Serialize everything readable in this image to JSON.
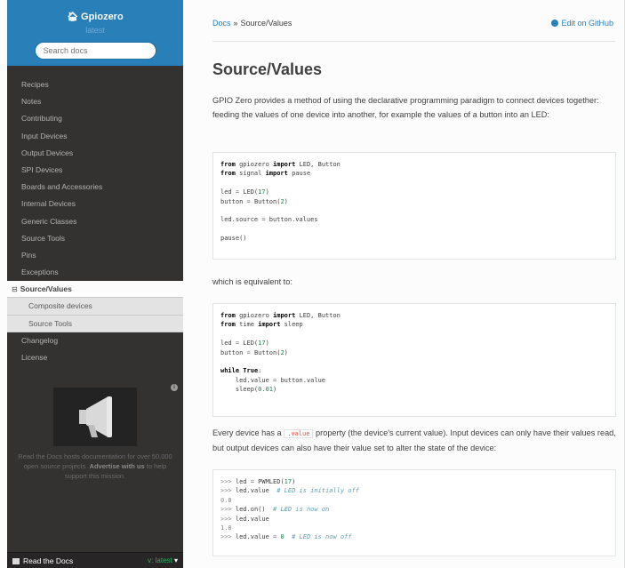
{
  "sidebar": {
    "project_name": "Gpiozero",
    "version": "latest",
    "search_placeholder": "Search docs",
    "nav_items": [
      "Recipes",
      "Notes",
      "Contributing",
      "Input Devices",
      "Output Devices",
      "SPI Devices",
      "Boards and Accessories",
      "Internal Devices",
      "Generic Classes",
      "Source Tools",
      "Pins",
      "Exceptions"
    ],
    "current_item": {
      "expander": "⊟",
      "label": "Source/Values"
    },
    "sub_items": [
      "Composite devices",
      "Source Tools"
    ],
    "nav_items_after": [
      "Changelog",
      "License"
    ],
    "ad": {
      "info": "i",
      "text_before": "Read the Docs hosts documentation for over 50,000 open source projects.",
      "text_link": "Advertise with us",
      "text_after": "to help support this mission."
    },
    "rtd_bar": {
      "label": "Read the Docs",
      "version": "v: latest",
      "caret": "▾"
    }
  },
  "header": {
    "breadcrumb_home": "Docs",
    "breadcrumb_sep": "»",
    "breadcrumb_current": "Source/Values",
    "edit_link": "Edit on GitHub"
  },
  "main": {
    "title": "Source/Values",
    "intro": "GPIO Zero provides a method of using the declarative programming paradigm to connect devices together: feeding the values of one device into another, for example the values of a button into an LED:",
    "equiv_text": "which is equivalent to:",
    "every_device_before": "Every device has a",
    "every_device_code": ".value",
    "every_device_after": "property (the device's current value). Input devices can only have their values read, but output devices can also have their value set to alter the state of the device:"
  },
  "colors": {
    "sidebar_bg": "#343131",
    "sidebar_header_bg": "#2980b9",
    "link": "#2980b9",
    "text": "#404040"
  }
}
